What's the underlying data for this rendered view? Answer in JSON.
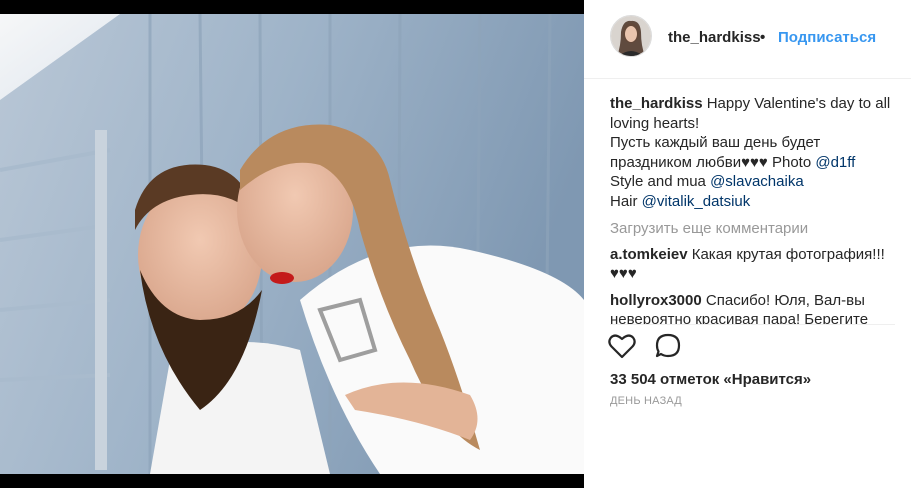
{
  "post": {
    "username": "the_hardkiss",
    "separator": "•",
    "follow_label": "Подписаться",
    "caption": {
      "username": "the_hardkiss",
      "line1": "Happy Valentine's day to all",
      "line2": "loving hearts!",
      "line3": "Пусть каждый ваш день будет",
      "line4": "праздником любви♥♥♥ Photo ",
      "photo_tag": "@d1ff",
      "style_prefix": "Style and mua ",
      "style_tag": "@slavachaika",
      "hair_prefix": "Hair ",
      "hair_tag": "@vitalik_datsiuk"
    },
    "load_more_label": "Загрузить еще комментарии",
    "comments": [
      {
        "username": "a.tomkeiev",
        "text": "Какая крутая фотография!!! ♥♥♥"
      },
      {
        "username": "hollyrox3000",
        "text": "Спасибо! Юля, Вал-вы невероятно красивая пара! Берегите"
      }
    ],
    "likes_label": "33 504 отметок «Нравится»",
    "time_label": "ДЕНЬ НАЗАД"
  },
  "icons": {
    "like": "heart-outline-icon",
    "comment": "speech-bubble-icon"
  },
  "colors": {
    "link_blue": "#3897f0",
    "tag_blue": "#003569",
    "muted_gray": "#999999",
    "text": "#262626"
  }
}
